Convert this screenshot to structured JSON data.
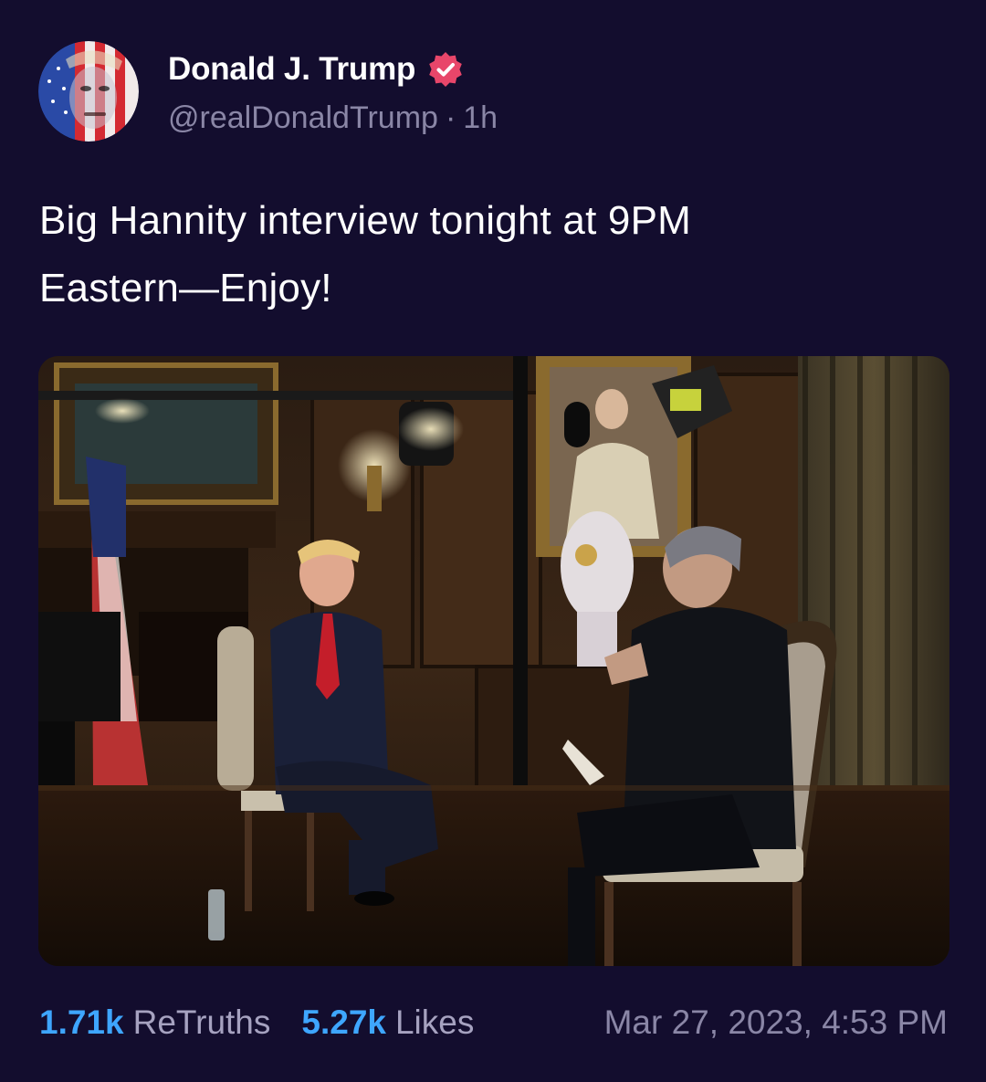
{
  "post": {
    "author": {
      "display_name": "Donald J. Trump",
      "handle": "@realDonaldTrump",
      "separator": "·",
      "relative_time": "1h",
      "verified": true,
      "avatar_icon": "flag-portrait-avatar",
      "verified_icon": "verified-badge-icon",
      "verified_color": "#e8466a"
    },
    "text": {
      "line1": "Big Hannity interview tonight at 9PM",
      "line2": "Eastern—Enjoy!"
    },
    "media": {
      "type": "photo",
      "alt": ""
    },
    "stats": {
      "retruths_count": "1.71k",
      "retruths_label": "ReTruths",
      "likes_count": "5.27k",
      "likes_label": "Likes"
    },
    "timestamp": "Mar 27, 2023, 4:53 PM"
  },
  "colors": {
    "background": "#130d2e",
    "accent": "#3ea6ff",
    "muted": "#8a86a6",
    "text": "#ffffff"
  }
}
